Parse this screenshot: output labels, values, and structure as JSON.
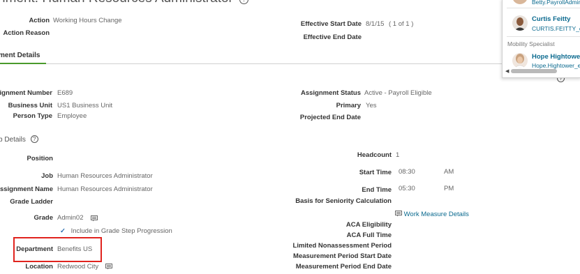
{
  "page": {
    "title": "nment: Human Resources Administrator",
    "help_glyph": "?"
  },
  "action": {
    "action_label": "Action",
    "action_value": "Working Hours Change",
    "reason_label": "Action Reason",
    "start_label": "Effective Start Date",
    "start_value": "8/1/15",
    "record_counter": "( 1 of 1 )",
    "end_label": "Effective End Date"
  },
  "tabs": [
    {
      "label": "ment Details",
      "selected": true
    }
  ],
  "assignment": {
    "number_label": "signment Number",
    "number_value": "E689",
    "bu_label": "Business Unit",
    "bu_value": "US1 Business Unit",
    "ptype_label": "Person Type",
    "ptype_value": "Employee",
    "status_label": "Assignment Status",
    "status_value": "Active - Payroll Eligible",
    "primary_label": "Primary",
    "primary_value": "Yes",
    "projected_end_label": "Projected End Date"
  },
  "job_details": {
    "section_title": "b Details",
    "position_label": "Position",
    "job_label": "Job",
    "job_value": "Human Resources Administrator",
    "aname_label": "ssignment Name",
    "aname_value": "Human Resources Administrator",
    "ladder_label": "Grade Ladder",
    "grade_label": "Grade",
    "grade_value": "Admin02",
    "grade_step_check": "✓",
    "grade_step_label": "Include in Grade Step Progression",
    "dept_label": "Department",
    "dept_value": "Benefits US",
    "location_label": "Location",
    "location_value": "Redwood City",
    "headcount_label": "Headcount",
    "headcount_value": "1",
    "start_time_label": "Start Time",
    "start_time_value": "08:30",
    "start_time_ampm": "AM",
    "end_time_label": "End Time",
    "end_time_value": "05:30",
    "end_time_ampm": "PM",
    "seniority_label": "Basis for Seniority Calculation",
    "work_measure_link": "Work Measure Details",
    "aca_elig_label": "ACA Eligibility",
    "aca_full_label": "ACA Full Time",
    "lnp_label": "Limited Nonassessment Period",
    "mp_start_label": "Measurement Period Start Date",
    "mp_end_label": "Measurement Period End Date"
  },
  "popup": {
    "top_email": "Betty.PayrollAdmin",
    "person1_name": "Curtis Feitty",
    "person1_email": "CURTIS.FEITTY_e",
    "role": "Mobility Specialist",
    "person2_name": "Hope Hightower",
    "person2_email": "Hope.Hightower_e"
  },
  "colors": {
    "link": "#0b6a8f",
    "tab_accent": "#4a9a2c",
    "highlight": "#e0231e"
  }
}
